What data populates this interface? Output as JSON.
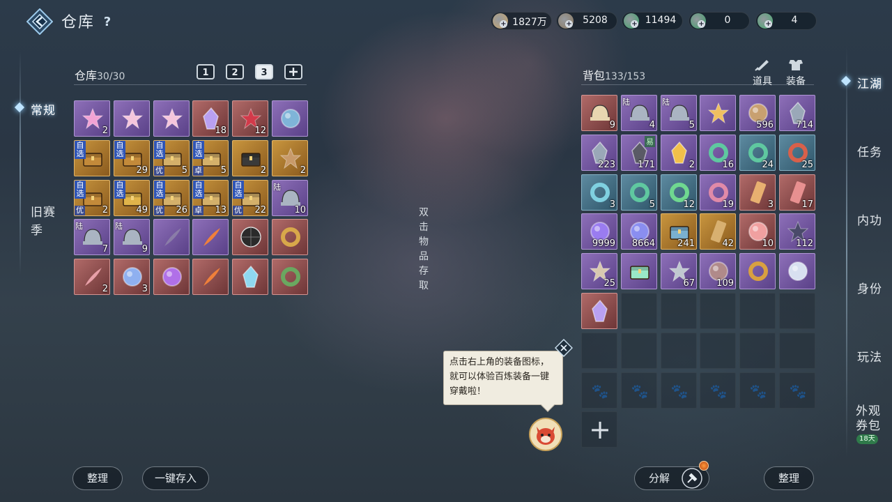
{
  "header": {
    "title": "仓库",
    "help": "?"
  },
  "currencies": [
    {
      "name": "tael-note",
      "value": "1827万",
      "color": "#c9a66b"
    },
    {
      "name": "coin",
      "value": "5208",
      "color": "#8c7a60"
    },
    {
      "name": "jade-pendant",
      "value": "11494",
      "color": "#3fa36b"
    },
    {
      "name": "jade-bead",
      "value": "0",
      "color": "#3f9d69"
    },
    {
      "name": "jade-ring",
      "value": "4",
      "color": "#48a870"
    }
  ],
  "left_tabs": [
    {
      "label": "常规",
      "active": true
    },
    {
      "label": "旧赛季",
      "active": false
    }
  ],
  "right_tabs": [
    {
      "label": "江湖",
      "active": true
    },
    {
      "label": "任务",
      "active": false
    },
    {
      "label": "内功",
      "active": false
    },
    {
      "label": "身份",
      "active": false
    },
    {
      "label": "玩法",
      "active": false
    },
    {
      "label": "外观券包",
      "active": false,
      "badge": "18天"
    }
  ],
  "warehouse": {
    "label": "仓库",
    "capacity": "30/30",
    "pages": [
      "1",
      "2",
      "3"
    ],
    "active_page": 2,
    "items": [
      {
        "q": "purple",
        "icon": "pink-cat-icon",
        "count": "2",
        "color": "#f2a3d4"
      },
      {
        "q": "purple",
        "icon": "lotus-icon",
        "count": "",
        "color": "#f5c6dc"
      },
      {
        "q": "purple",
        "icon": "lotus-icon",
        "count": "",
        "color": "#f5c6dc"
      },
      {
        "q": "red",
        "icon": "crystal-icon",
        "count": "18",
        "color": "#b9a0f2"
      },
      {
        "q": "red",
        "icon": "rose-bouquet-icon",
        "count": "12",
        "color": "#d23a4a"
      },
      {
        "q": "purple",
        "icon": "mirror-icon",
        "count": "",
        "color": "#7fb4d8"
      },
      {
        "q": "orange",
        "icon": "chest-icon",
        "count": "",
        "tag": "自选",
        "color": "#c38a3a"
      },
      {
        "q": "orange",
        "icon": "chest-icon",
        "count": "29",
        "tag": "自选",
        "color": "#c38a3a"
      },
      {
        "q": "orange",
        "icon": "scroll-chest-icon",
        "count": "5",
        "tag": "自选",
        "btag": "优",
        "color": "#d4b06a"
      },
      {
        "q": "orange",
        "icon": "scroll-chest-icon",
        "count": "5",
        "tag": "自选",
        "btag": "卓",
        "color": "#d4b06a"
      },
      {
        "q": "orange",
        "icon": "dark-chest-icon",
        "count": "2",
        "color": "#3a3a3a"
      },
      {
        "q": "orange",
        "icon": "portrait-icon",
        "count": "2",
        "color": "#c89a6a"
      },
      {
        "q": "orange",
        "icon": "chest-icon",
        "count": "2",
        "tag": "自选",
        "btag": "优",
        "color": "#c38a3a"
      },
      {
        "q": "orange",
        "icon": "gold-chest-icon",
        "count": "49",
        "tag": "自选",
        "color": "#e0b44a"
      },
      {
        "q": "orange",
        "icon": "scroll-chest-icon",
        "count": "26",
        "tag": "自选",
        "btag": "优",
        "color": "#d4b06a"
      },
      {
        "q": "orange",
        "icon": "scroll-chest-icon",
        "count": "13",
        "tag": "自选",
        "btag": "卓",
        "color": "#d4b06a"
      },
      {
        "q": "orange",
        "icon": "scroll-chest-icon",
        "count": "22",
        "tag": "自选",
        "btag": "优",
        "color": "#d4b06a"
      },
      {
        "q": "purple",
        "icon": "helmet-icon",
        "count": "10",
        "ltag": "陆",
        "color": "#aab4c2"
      },
      {
        "q": "purple",
        "icon": "helmet-icon",
        "count": "7",
        "ltag": "陆",
        "color": "#aab4c2"
      },
      {
        "q": "purple",
        "icon": "helmet-icon",
        "count": "9",
        "ltag": "陆",
        "color": "#aab4c2"
      },
      {
        "q": "purple",
        "icon": "sword-icon",
        "count": "",
        "color": "#8a7ca8"
      },
      {
        "q": "purple",
        "icon": "phoenix-feather-icon",
        "count": "",
        "color": "#f0803a"
      },
      {
        "q": "red",
        "icon": "umbrella-icon",
        "count": "",
        "color": "#2a2a2a"
      },
      {
        "q": "red",
        "icon": "gold-ring-icon",
        "count": "",
        "color": "#d8a84a"
      },
      {
        "q": "red",
        "icon": "plum-branch-icon",
        "count": "2",
        "color": "#e8a0a8"
      },
      {
        "q": "red",
        "icon": "star-orb-icon",
        "count": "3",
        "color": "#8fb0f0"
      },
      {
        "q": "red",
        "icon": "purple-orb-icon",
        "count": "",
        "color": "#b070e8"
      },
      {
        "q": "red",
        "icon": "phoenix-feather-icon",
        "count": "",
        "color": "#f0803a"
      },
      {
        "q": "red",
        "icon": "ice-crystal-icon",
        "count": "",
        "color": "#8fd8f0"
      },
      {
        "q": "red",
        "icon": "wreath-icon",
        "count": "",
        "color": "#6aa860"
      }
    ]
  },
  "middle_vertical_text": "双击物品存取",
  "backpack": {
    "label": "背包",
    "capacity": "133/153",
    "tabs": [
      {
        "label": "道具",
        "icon": "quill-icon"
      },
      {
        "label": "装备",
        "icon": "armor-icon"
      }
    ],
    "items": [
      {
        "q": "red",
        "icon": "hat-icon",
        "count": "9",
        "color": "#e8d6b0"
      },
      {
        "q": "purple",
        "icon": "helmet-icon",
        "count": "4",
        "ltag": "陆",
        "color": "#aab4c2"
      },
      {
        "q": "purple",
        "icon": "helmet-icon",
        "count": "5",
        "ltag": "陆",
        "color": "#aab4c2"
      },
      {
        "q": "purple",
        "icon": "cloth-icon",
        "count": "",
        "color": "#f0c060"
      },
      {
        "q": "purple",
        "icon": "coin-medal-icon",
        "count": "596",
        "color": "#c8a070"
      },
      {
        "q": "purple",
        "icon": "ore-icon",
        "count": "714",
        "color": "#9aa8b8"
      },
      {
        "q": "purple",
        "icon": "ore-icon",
        "count": "223",
        "color": "#9aa8b8"
      },
      {
        "q": "purple",
        "icon": "black-ore-icon",
        "count": "171",
        "gtag": "易",
        "color": "#5a5a66"
      },
      {
        "q": "purple",
        "icon": "gold-crystal-icon",
        "count": "2",
        "color": "#f2c04a"
      },
      {
        "q": "purple",
        "icon": "jade-ring-icon",
        "count": "16",
        "color": "#5fc8a0"
      },
      {
        "q": "teal",
        "icon": "jade-ring-icon",
        "count": "24",
        "color": "#5fc8a0"
      },
      {
        "q": "teal",
        "icon": "red-ring-icon",
        "count": "25",
        "color": "#d8604a"
      },
      {
        "q": "teal",
        "icon": "jade-ring-icon",
        "count": "3",
        "color": "#7fd0e0"
      },
      {
        "q": "teal",
        "icon": "jade-ring-icon",
        "count": "5",
        "color": "#5fc8a0"
      },
      {
        "q": "teal",
        "icon": "jade-ring-icon",
        "count": "12",
        "color": "#6fd890"
      },
      {
        "q": "purple",
        "icon": "pink-ring-icon",
        "count": "19",
        "color": "#e08aa8"
      },
      {
        "q": "red",
        "icon": "talisman-icon",
        "count": "3",
        "color": "#e8b070"
      },
      {
        "q": "red",
        "icon": "talisman-icon",
        "count": "17",
        "color": "#e89090"
      },
      {
        "q": "purple",
        "icon": "eye-orb-icon",
        "count": "9999",
        "color": "#9a7cf0"
      },
      {
        "q": "purple",
        "icon": "eye-orb-icon",
        "count": "8664",
        "color": "#8a8ef0"
      },
      {
        "q": "orange",
        "icon": "book-icon",
        "count": "241",
        "color": "#7ab0d0"
      },
      {
        "q": "orange",
        "icon": "map-scroll-icon",
        "count": "42",
        "color": "#d8b070"
      },
      {
        "q": "red",
        "icon": "pearl-tray-icon",
        "count": "10",
        "color": "#f0a0a0"
      },
      {
        "q": "purple",
        "icon": "figure-icon",
        "count": "112",
        "color": "#4a4a6a"
      },
      {
        "q": "purple",
        "icon": "bracer-icon",
        "count": "25",
        "color": "#d8c8b0"
      },
      {
        "q": "purple",
        "icon": "jade-box-icon",
        "count": "",
        "color": "#9ae8c8"
      },
      {
        "q": "purple",
        "icon": "armguard-icon",
        "count": "67",
        "color": "#c0c8d0"
      },
      {
        "q": "purple",
        "icon": "bowl-icon",
        "count": "109",
        "color": "#b08a8a"
      },
      {
        "q": "purple",
        "icon": "ruby-ring-icon",
        "count": "",
        "color": "#d8a040"
      },
      {
        "q": "purple",
        "icon": "pearl-plate-icon",
        "count": "",
        "color": "#d8e0f0"
      },
      {
        "q": "red",
        "icon": "crystal-icon",
        "count": "",
        "color": "#b9a0f2"
      }
    ],
    "empty_slots": 11,
    "locked_slots": 6,
    "add_slot_label": "+"
  },
  "tooltip": "点击右上角的装备图标，就可以体验百炼装备一键穿戴啦！",
  "buttons": {
    "sort_left": "整理",
    "deposit_all": "一键存入",
    "decompose": "分解",
    "sort_right": "整理"
  }
}
